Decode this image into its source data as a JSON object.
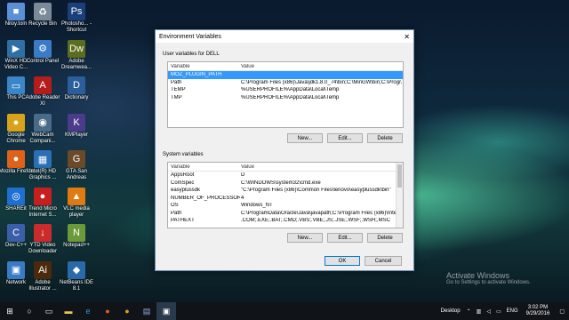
{
  "desktop_icons": [
    {
      "label": "Niloy.tom",
      "glyph": "■",
      "color": "#5b8fd6"
    },
    {
      "label": "Recycle Bin",
      "glyph": "♻",
      "color": "#7a8a99"
    },
    {
      "label": "Photosho... - Shortcut",
      "glyph": "Ps",
      "color": "#1b3f7a"
    },
    {
      "label": "WinX HD Video C...",
      "glyph": "▶",
      "color": "#2f6fa3"
    },
    {
      "label": "Control Panel",
      "glyph": "⚙",
      "color": "#3a7bc8"
    },
    {
      "label": "Adobe Dreamwea...",
      "glyph": "Dw",
      "color": "#5a6e1e"
    },
    {
      "label": "This PC",
      "glyph": "▭",
      "color": "#3a86c8"
    },
    {
      "label": "Adobe Reader XI",
      "glyph": "A",
      "color": "#b51d1d"
    },
    {
      "label": "Dictionary",
      "glyph": "D",
      "color": "#2c5e9c"
    },
    {
      "label": "Google Chrome",
      "glyph": "●",
      "color": "#d9a21b"
    },
    {
      "label": "WebCam Compani...",
      "glyph": "◉",
      "color": "#4a6a8a"
    },
    {
      "label": "KMPlayer",
      "glyph": "K",
      "color": "#4b3b8a"
    },
    {
      "label": "Mozilla Firefox",
      "glyph": "●",
      "color": "#e0621a"
    },
    {
      "label": "Intel(R) HD Graphics ...",
      "glyph": "▦",
      "color": "#2a6fb5"
    },
    {
      "label": "GTA San Andreas",
      "glyph": "G",
      "color": "#6b4a2a"
    },
    {
      "label": "SHAREit",
      "glyph": "◎",
      "color": "#1e6fd0"
    },
    {
      "label": "Trend Micro Internet S...",
      "glyph": "●",
      "color": "#c71e1e"
    },
    {
      "label": "VLC media player",
      "glyph": "▲",
      "color": "#e07a12"
    },
    {
      "label": "Dev-C++",
      "glyph": "C",
      "color": "#3b5ea8"
    },
    {
      "label": "YTD Video Downloader",
      "glyph": "↓",
      "color": "#cc2b2b"
    },
    {
      "label": "Notepad++",
      "glyph": "N",
      "color": "#6a9a3a"
    },
    {
      "label": "Network",
      "glyph": "▣",
      "color": "#3a7bc8"
    },
    {
      "label": "Adobe Illustrator ...",
      "glyph": "Ai",
      "color": "#4a2a0a"
    },
    {
      "label": "NetBeans IDE 8.1",
      "glyph": "◆",
      "color": "#2a6aa8"
    }
  ],
  "dialog": {
    "title": "Environment Variables",
    "user_group_label": "User variables for DELL",
    "system_group_label": "System variables",
    "col_variable": "Variable",
    "col_value": "Value",
    "user_vars": [
      {
        "variable": "MOZ_PLUGIN_PATH",
        "value": ""
      },
      {
        "variable": "Path",
        "value": "C:\\Program Files (x86)\\Java\\jdk1.8.0_74\\bin;C:\\MinGW\\bin;C:\\Progr..."
      },
      {
        "variable": "TEMP",
        "value": "%USERPROFILE%\\AppData\\Local\\Temp"
      },
      {
        "variable": "TMP",
        "value": "%USERPROFILE%\\AppData\\Local\\Temp"
      }
    ],
    "system_vars": [
      {
        "variable": "AppsRoot",
        "value": "D"
      },
      {
        "variable": "ComSpec",
        "value": "C:\\WINDOWS\\system32\\cmd.exe"
      },
      {
        "variable": "easyplussdk",
        "value": "\"C:\\Program Files (x86)\\Common Files\\lenovo\\easyplussdk\\bin\""
      },
      {
        "variable": "NUMBER_OF_PROCESSORS",
        "value": "4"
      },
      {
        "variable": "OS",
        "value": "Windows_NT"
      },
      {
        "variable": "Path",
        "value": "C:\\ProgramData\\Oracle\\Java\\javapath;C:\\Program Files (x86)\\Intel\\i..."
      },
      {
        "variable": "PATHEXT",
        "value": ".COM;.EXE;.BAT;.CMD;.VBS;.VBE;.JS;.JSE;.WSF;.WSH;.MSC"
      }
    ],
    "btn_new": "New...",
    "btn_edit": "Edit...",
    "btn_delete": "Delete",
    "btn_ok": "OK",
    "btn_cancel": "Cancel"
  },
  "watermark": {
    "line1": "Activate Windows",
    "line2": "Go to Settings to activate Windows."
  },
  "taskbar": {
    "desktop_label": "Desktop",
    "language": "ENG",
    "time": "3:02 PM",
    "date": "9/29/2016"
  }
}
